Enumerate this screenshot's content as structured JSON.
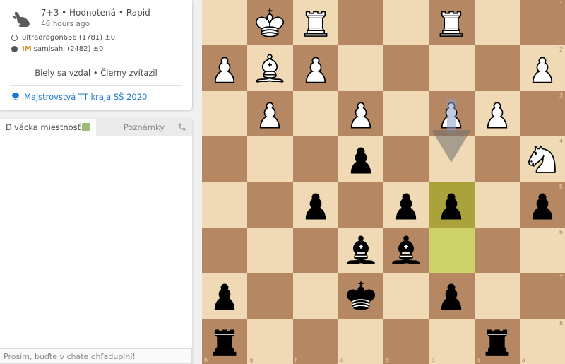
{
  "game": {
    "speed": "7+3 • Hodnotená • Rapid",
    "ago": "46 hours ago",
    "white_player": "ultradragon656 (1781) ±0",
    "black_title": "IM",
    "black_player": "samisahi (2482) ±0",
    "result": "Biely sa vzdal • Čierny zvíťazil",
    "tournament": "Majstrovstvá TT kraja SŠ 2020"
  },
  "chat": {
    "tab_room": "Divácka miestnosť",
    "tab_notes": "Poznámky",
    "placeholder": "Prosím, buďte v chate ohľaduplní!"
  },
  "board": {
    "orientation": "black",
    "files": [
      "h",
      "g",
      "f",
      "e",
      "d",
      "c",
      "b",
      "a"
    ],
    "ranks": [
      "1",
      "2",
      "3",
      "4",
      "5",
      "6",
      "7",
      "8"
    ],
    "rows": [
      [
        "",
        "wK",
        "wR",
        "",
        "",
        "wR",
        "",
        ""
      ],
      [
        "wP",
        "wB",
        "wP",
        "",
        "",
        "",
        "",
        "wP"
      ],
      [
        "",
        "wP",
        "",
        "wP",
        "",
        "wP",
        "wP",
        ""
      ],
      [
        "",
        "",
        "",
        "bP",
        "",
        "",
        "",
        "wN"
      ],
      [
        "",
        "",
        "bP",
        "",
        "bP",
        "bP",
        "",
        "bP"
      ],
      [
        "",
        "",
        "",
        "bB",
        "bB",
        "",
        "",
        ""
      ],
      [
        "bP",
        "",
        "",
        "bK",
        "",
        "bP",
        "",
        ""
      ],
      [
        "bR",
        "",
        "",
        "",
        "",
        "",
        "bR",
        ""
      ]
    ],
    "last_move": [
      "c6",
      "c5"
    ],
    "arrow": {
      "from": "c3",
      "to": "c4"
    },
    "colors": {
      "light": "#f0d9b5",
      "dark": "#b58863",
      "highlight_light": "#cdd26a",
      "highlight_dark": "#aaa23a"
    }
  }
}
